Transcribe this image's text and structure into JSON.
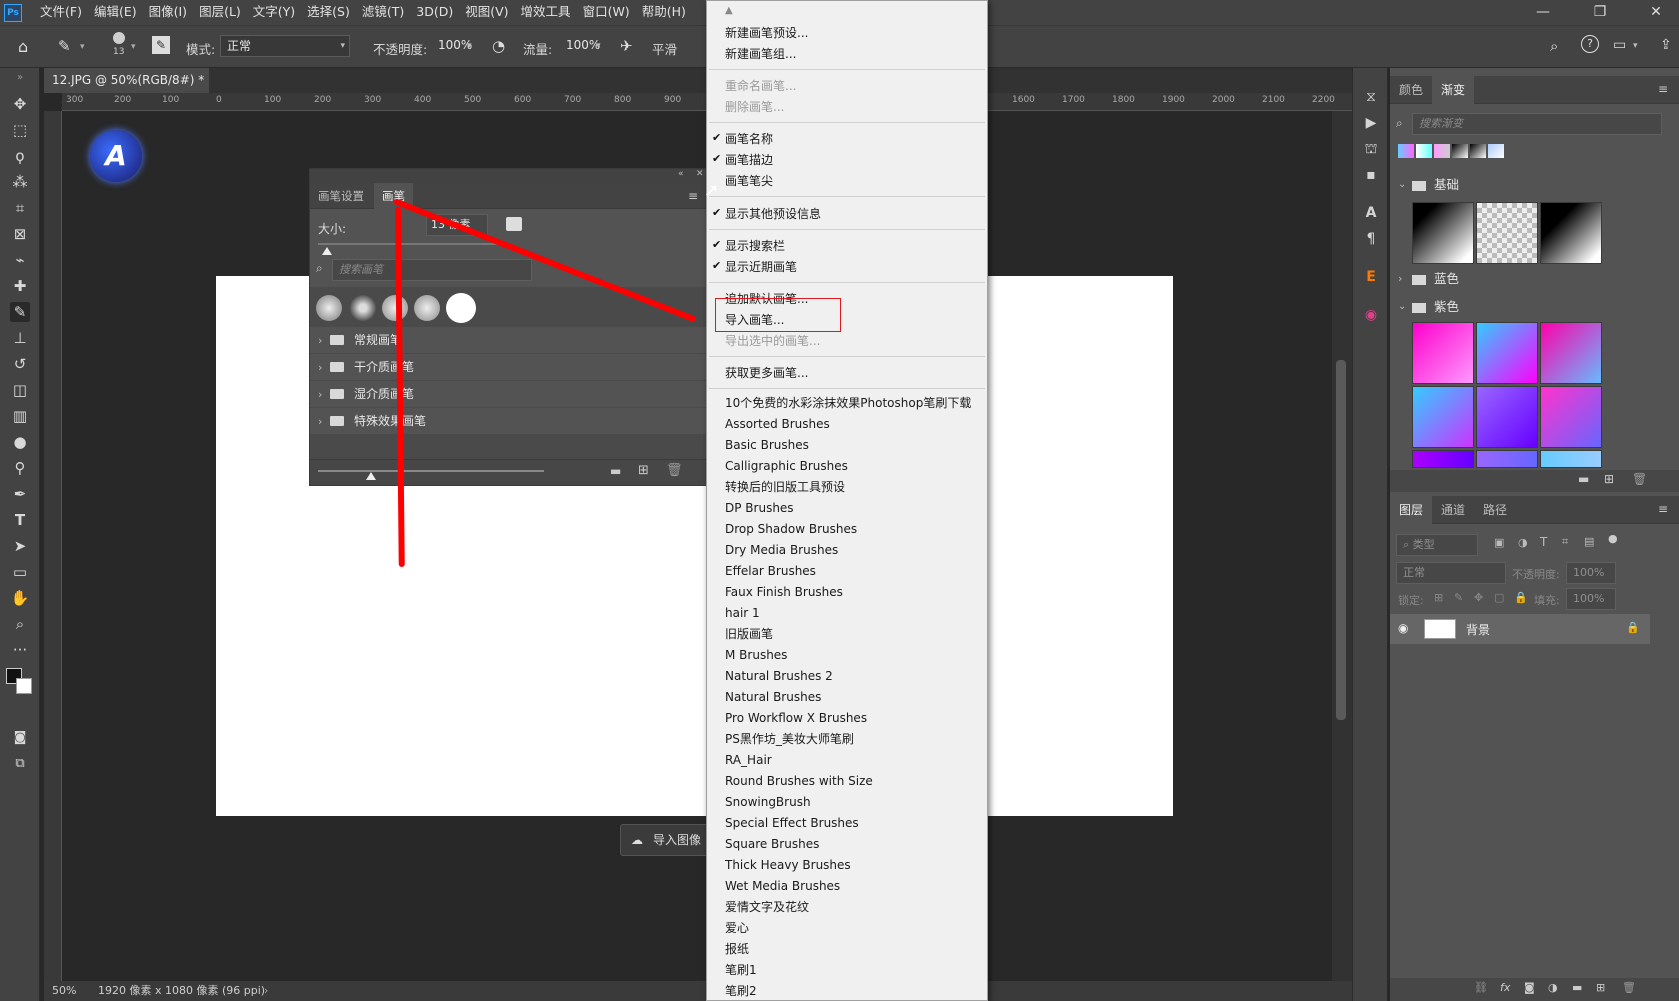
{
  "app": {
    "logo": "Ps"
  },
  "menubar": {
    "items": [
      "文件(F)",
      "编辑(E)",
      "图像(I)",
      "图层(L)",
      "文字(Y)",
      "选择(S)",
      "滤镜(T)",
      "3D(D)",
      "视图(V)",
      "增效工具",
      "窗口(W)",
      "帮助(H)"
    ]
  },
  "window_controls": {
    "minimize": "—",
    "restore": "❐",
    "close": "✕"
  },
  "options_bar": {
    "brush_size": "13",
    "mode_label": "模式:",
    "mode_value": "正常",
    "opacity_label": "不透明度:",
    "opacity_value": "100%",
    "flow_label": "流量:",
    "flow_value": "100%",
    "smooth_label": "平滑"
  },
  "document_tab": {
    "title": "12.JPG @ 50%(RGB/8#) *",
    "close": "×"
  },
  "ruler": {
    "labels": [
      "300",
      "200",
      "100",
      "0",
      "100",
      "200",
      "300",
      "400",
      "500",
      "600",
      "700",
      "800",
      "900",
      "1600",
      "1700",
      "1800",
      "1900",
      "2000",
      "2100",
      "2200"
    ]
  },
  "status_bar": {
    "zoom": "50%",
    "doc_info": "1920 像素 x 1080 像素 (96 ppi)"
  },
  "import_chip": {
    "label": "导入图像"
  },
  "brush_panel": {
    "tabs": [
      "画笔设置",
      "画笔"
    ],
    "active_tab": "画笔",
    "size_label": "大小:",
    "size_value": "13 像素",
    "search_placeholder": "搜索画笔",
    "folders": [
      "常规画笔",
      "干介质画笔",
      "湿介质画笔",
      "特殊效果画笔"
    ]
  },
  "context_menu": {
    "group1": [
      "新建画笔预设...",
      "新建画笔组..."
    ],
    "group2": [
      "重命名画笔...",
      "删除画笔..."
    ],
    "group3": [
      {
        "label": "画笔名称",
        "checked": true
      },
      {
        "label": "画笔描边",
        "checked": true
      },
      {
        "label": "画笔笔尖",
        "checked": false
      }
    ],
    "group4": [
      {
        "label": "显示其他预设信息",
        "checked": true
      }
    ],
    "group5": [
      {
        "label": "显示搜索栏",
        "checked": true
      },
      {
        "label": "显示近期画笔",
        "checked": true
      }
    ],
    "group6": [
      {
        "label": "追加默认画笔...",
        "disabled": false
      },
      {
        "label": "导入画笔...",
        "disabled": false,
        "highlighted": true
      },
      {
        "label": "导出选中的画笔...",
        "disabled": true
      }
    ],
    "group7": [
      "获取更多画笔..."
    ],
    "brush_sets": [
      "10个免费的水彩涂抹效果Photoshop笔刷下载",
      "Assorted Brushes",
      "Basic Brushes",
      "Calligraphic Brushes",
      "转换后的旧版工具预设",
      "DP Brushes",
      "Drop Shadow Brushes",
      "Dry Media Brushes",
      "Effelar Brushes",
      "Faux Finish Brushes",
      "hair 1",
      "旧版画笔",
      "M Brushes",
      "Natural Brushes 2",
      "Natural Brushes",
      "Pro Workflow X Brushes",
      "PS黑作坊_美妆大师笔刷",
      "RA_Hair",
      "Round Brushes with Size",
      "SnowingBrush",
      "Special Effect Brushes",
      "Square Brushes",
      "Thick Heavy Brushes",
      "Wet Media Brushes",
      "爱情文字及花纹",
      "爱心",
      "报纸",
      "笔刷1",
      "笔刷2"
    ]
  },
  "right_panel": {
    "top_tabs": [
      "颜色",
      "渐变"
    ],
    "top_active": "渐变",
    "gradient_search_placeholder": "搜索渐变",
    "groups": [
      "基础",
      "蓝色",
      "紫色"
    ],
    "layers_tabs": [
      "图层",
      "通道",
      "路径"
    ],
    "layers_active": "图层",
    "kind_placeholder": "类型",
    "blend_mode": "正常",
    "opacity_label": "不透明度:",
    "opacity_value": "100%",
    "lock_label": "锁定:",
    "fill_label": "填充:",
    "fill_value": "100%",
    "layer_name": "背景"
  },
  "annotation_colors": {
    "arrow": "#ff0000",
    "highlight_box": "#e0191f"
  }
}
